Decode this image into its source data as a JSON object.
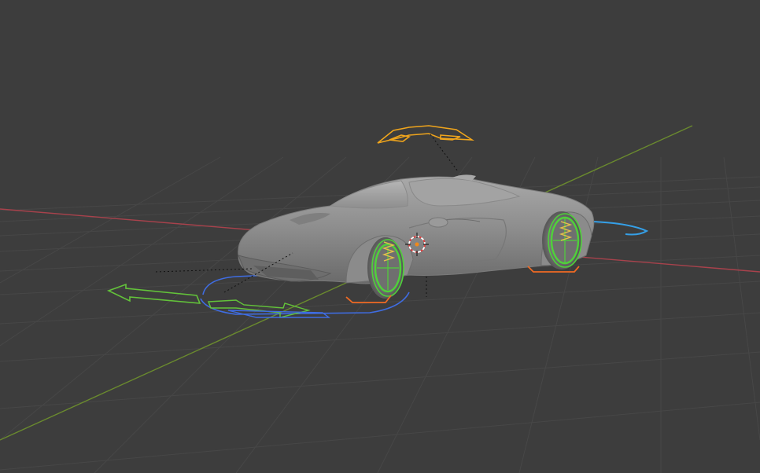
{
  "viewport": {
    "background": "#3d3d3d",
    "grid_color": "#4a4a4a",
    "x_axis_color": "#a8424c",
    "y_axis_color": "#6a8a2e"
  },
  "scene": {
    "object": "car-mesh",
    "rig_controls": [
      {
        "name": "roof-control",
        "color": "#f0a51c"
      },
      {
        "name": "root-move-arrows",
        "color": "#63c33a"
      },
      {
        "name": "ground-path-control",
        "color": "#3f6de3"
      },
      {
        "name": "steer-control",
        "color": "#35a0e8"
      },
      {
        "name": "wheel-control",
        "color": "#4fd13a"
      },
      {
        "name": "suspension-spring",
        "color": "#e6c24a"
      },
      {
        "name": "tire-contact-control",
        "color": "#f06a23"
      }
    ],
    "cursor": "3d-cursor"
  }
}
